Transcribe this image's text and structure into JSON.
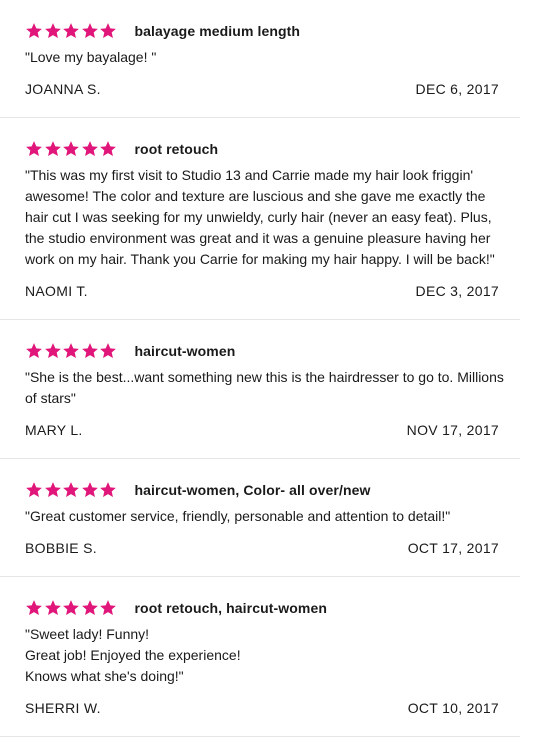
{
  "colors": {
    "star": "#e0167a",
    "divider": "#e6e6e6",
    "text": "#1a1a1a"
  },
  "reviews": [
    {
      "rating": 5,
      "service": "balayage medium length",
      "text": "\"Love my bayalage!  \"",
      "author": "JOANNA S.",
      "date": "DEC 6, 2017"
    },
    {
      "rating": 5,
      "service": "root retouch",
      "text": "\"This was my first visit to Studio 13 and Carrie made my hair look friggin' awesome! The color and texture are luscious and she gave me exactly the hair cut I was seeking for my unwieldy, curly hair (never an easy feat). Plus, the studio environment was great and it was a genuine pleasure having her work on my hair. Thank you Carrie for making my hair happy. I will be back!\"",
      "author": "NAOMI T.",
      "date": "DEC 3, 2017"
    },
    {
      "rating": 5,
      "service": "haircut-women",
      "text": "\"She  is the best...want something  new this is  the hairdresser to go to.  Millions  of stars\"",
      "author": "MARY L.",
      "date": "NOV 17, 2017"
    },
    {
      "rating": 5,
      "service": "haircut-women, Color- all over/new",
      "text": "\"Great customer service, friendly, personable and attention to detail!\"",
      "author": "BOBBIE S.",
      "date": "OCT 17, 2017"
    },
    {
      "rating": 5,
      "service": "root retouch, haircut-women",
      "text": "\"Sweet lady! Funny!\nGreat job! Enjoyed the experience!\nKnows what she's doing!\"",
      "author": "SHERRI W.",
      "date": "OCT 10, 2017"
    }
  ]
}
